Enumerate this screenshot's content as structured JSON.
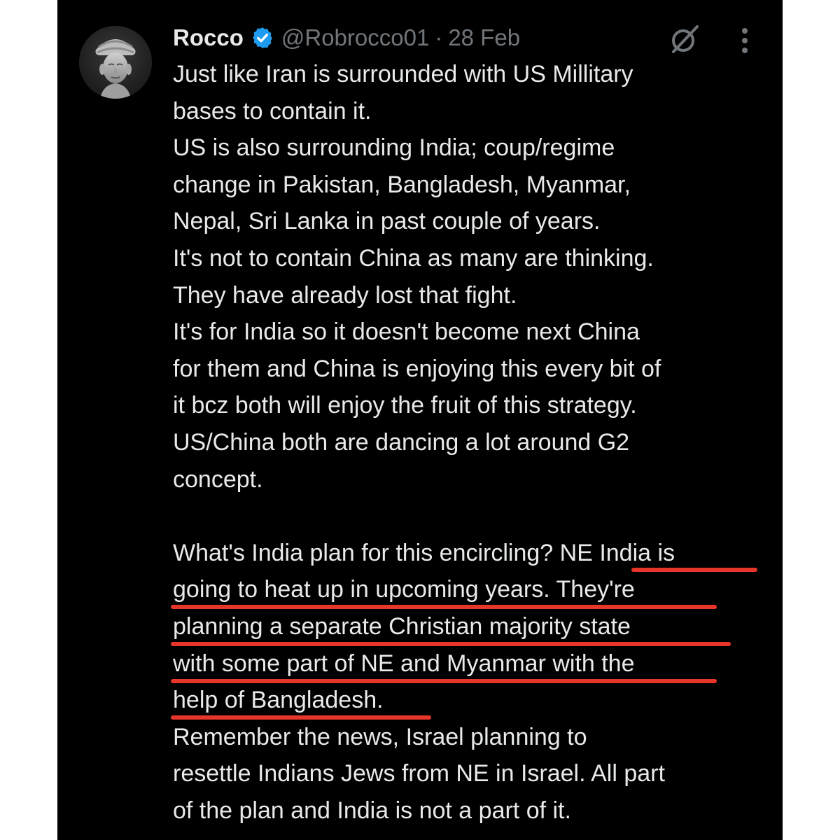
{
  "tweet": {
    "author_name": "Rocco",
    "handle": "@Robrocco01",
    "separator": "·",
    "date": "28 Feb",
    "avatar_icon": "statue-portrait-avatar",
    "verified_icon": "verified-badge-icon",
    "verified_color": "#1d9bf0",
    "body_lines": [
      "Just like Iran is surrounded with US Millitary",
      "bases to contain it.",
      "US is also surrounding India; coup/regime",
      "change in Pakistan, Bangladesh, Myanmar,",
      "Nepal, Sri Lanka in past couple of years.",
      "It's not to contain China as many are thinking.",
      "They have already lost that fight.",
      "It's for India so it doesn't become next China",
      "for them and China is enjoying this every bit of",
      "it bcz both will enjoy the fruit of this strategy.",
      "US/China both are dancing a lot around G2",
      "concept.",
      "",
      "What's India plan for this encircling? NE India is",
      "going to heat up in upcoming years. They're",
      "planning a separate Christian majority state",
      "with some part of NE and Myanmar with the",
      "help of Bangladesh.",
      "Remember the news, Israel planning to",
      "resettle Indians Jews from NE in Israel. All part",
      "of the plan and India is not a part of it."
    ],
    "highlight_color": "#e8352a"
  },
  "toolbar": {
    "grok_icon": "grok-icon",
    "more_icon": "more-options-icon"
  }
}
